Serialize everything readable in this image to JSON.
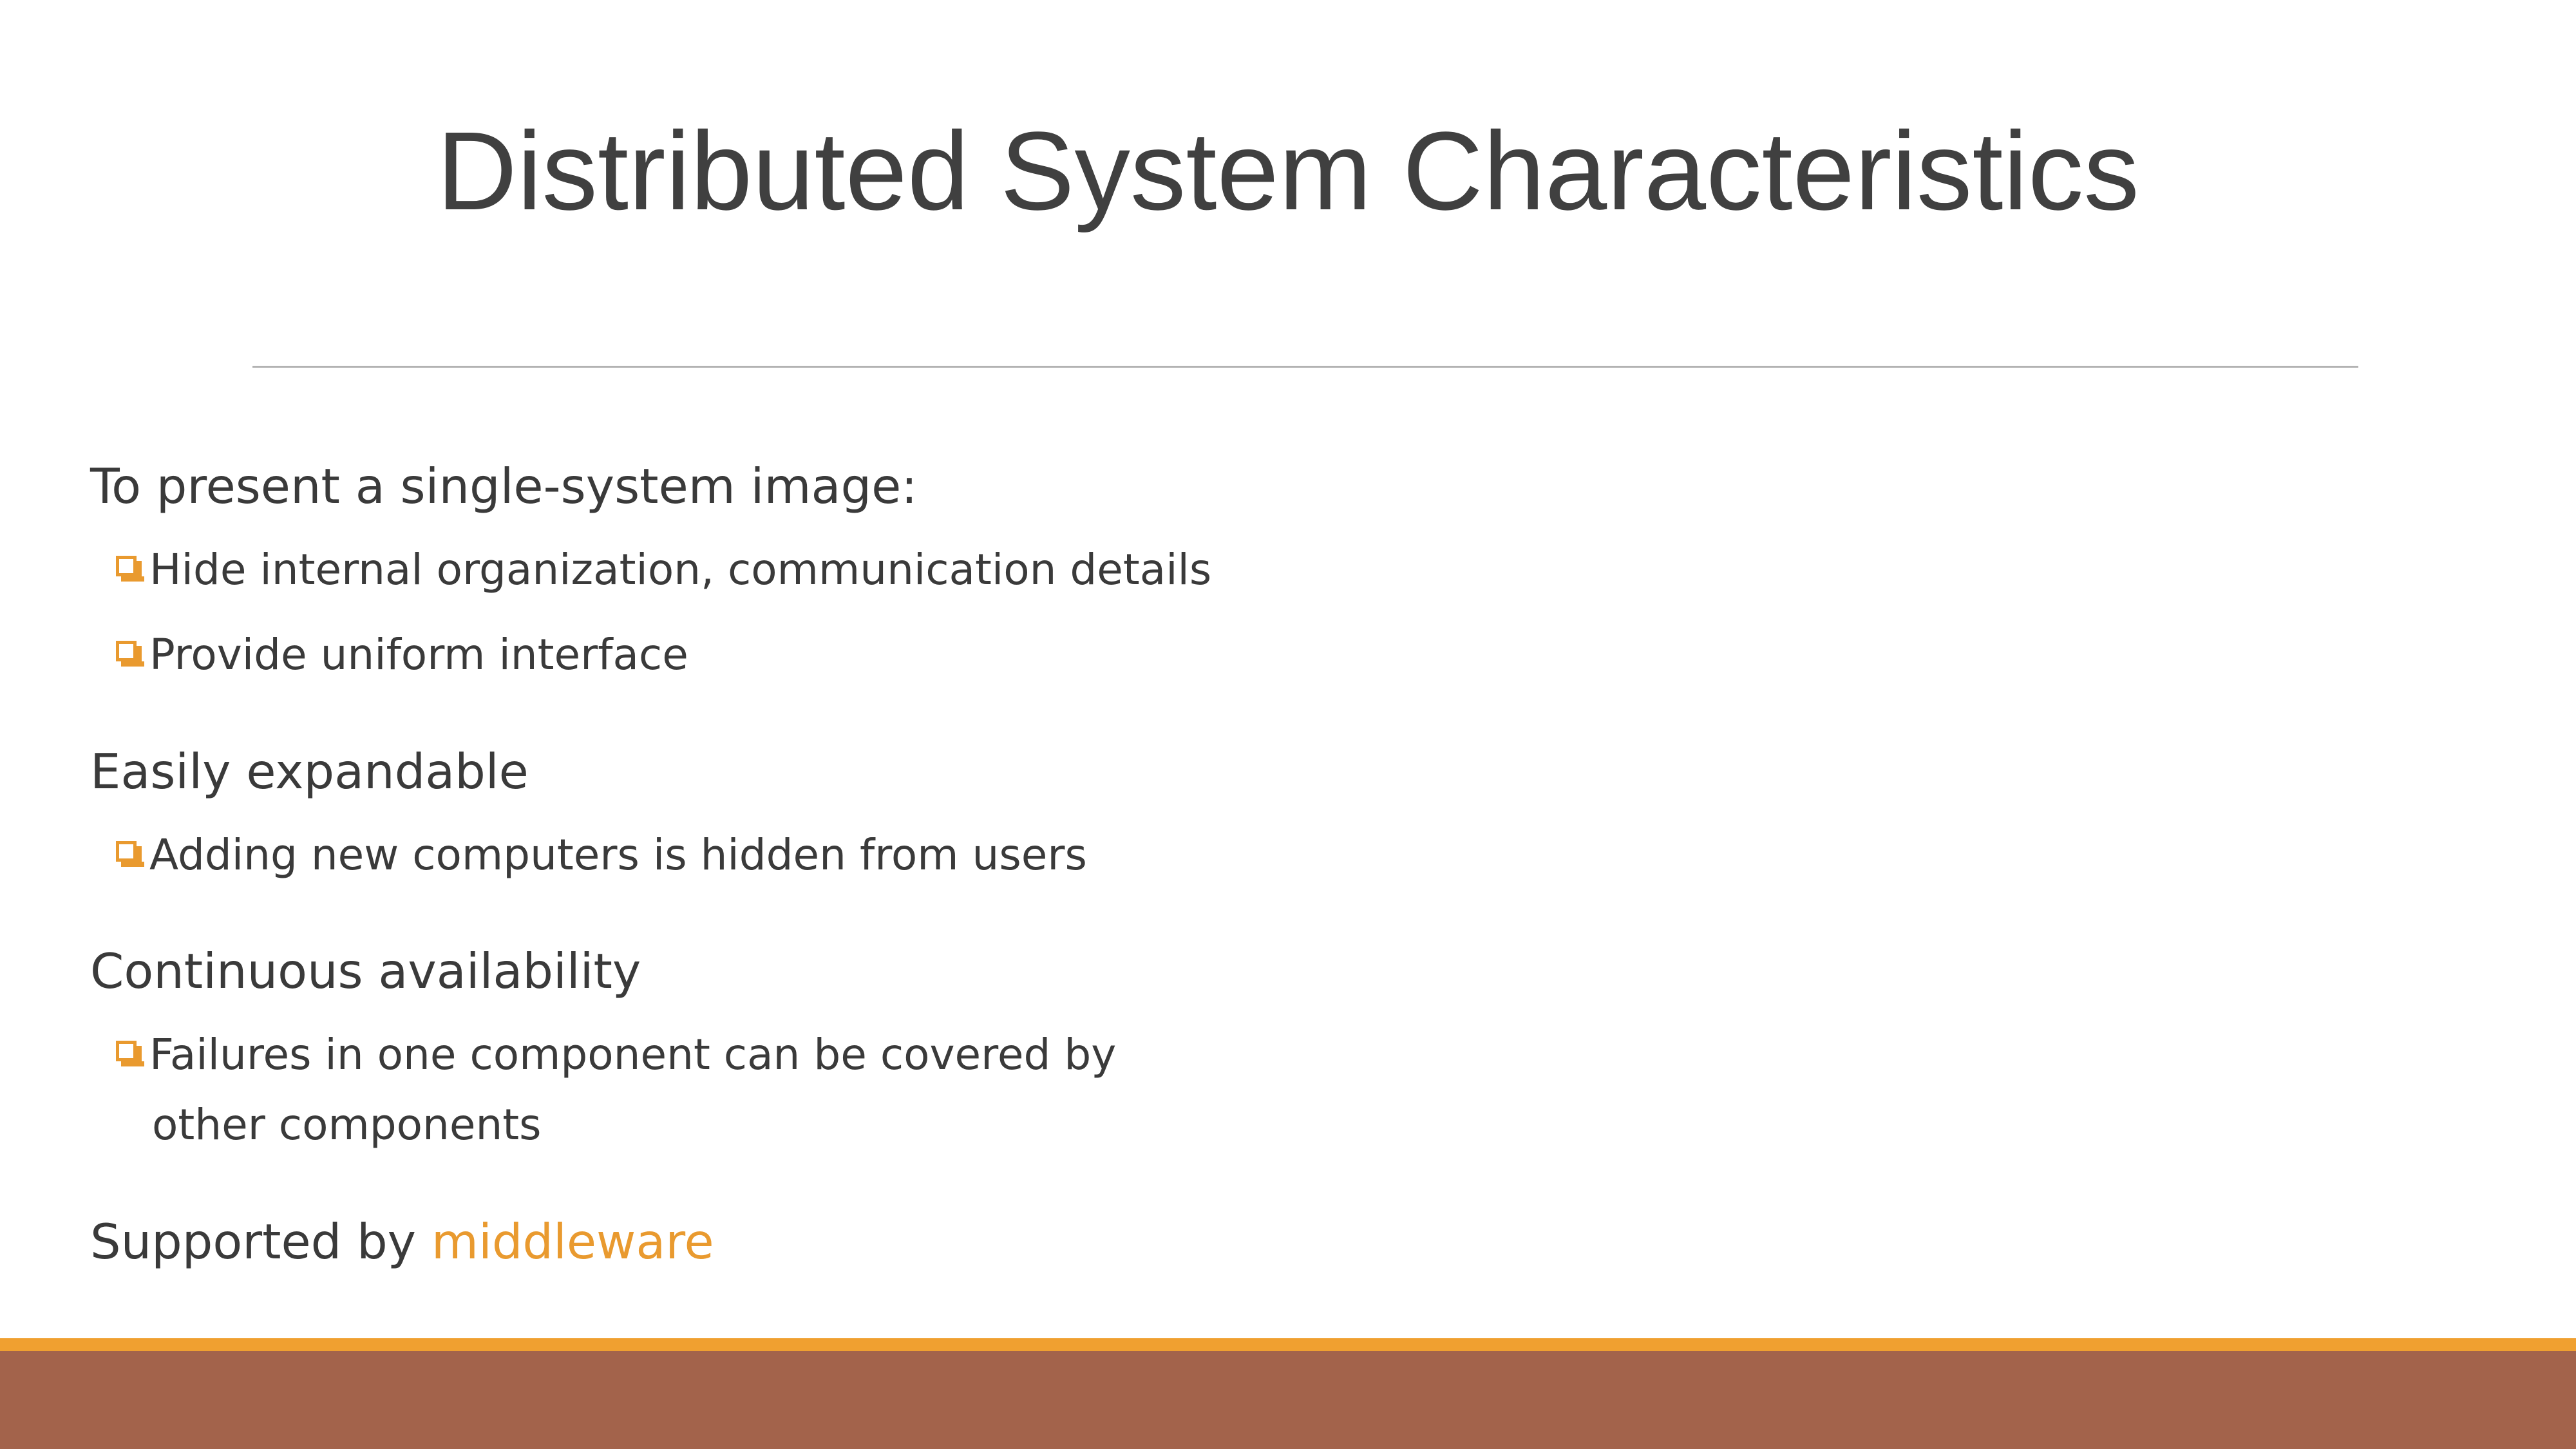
{
  "slide": {
    "title": "Distributed System Characteristics",
    "sections": [
      {
        "heading": "To present a single-system image:",
        "bullets": [
          "Hide internal organization, communication details",
          "Provide uniform interface"
        ]
      },
      {
        "heading": "Easily expandable",
        "bullets": [
          "Adding new computers is hidden from users"
        ]
      },
      {
        "heading": "Continuous availability",
        "bullets": [
          "Failures in one component can be covered by"
        ],
        "continuation": "other components"
      }
    ],
    "closing": {
      "prefix": "Supported by ",
      "highlight": "middleware"
    }
  },
  "colors": {
    "accent": "#e99a2f",
    "footer_stripe": "#f0a030",
    "footer_bar": "#a3634b",
    "text": "#3a3a3a",
    "title_text": "#404040"
  },
  "icons": {
    "bullet": "shadowed-square-bullet-icon"
  }
}
